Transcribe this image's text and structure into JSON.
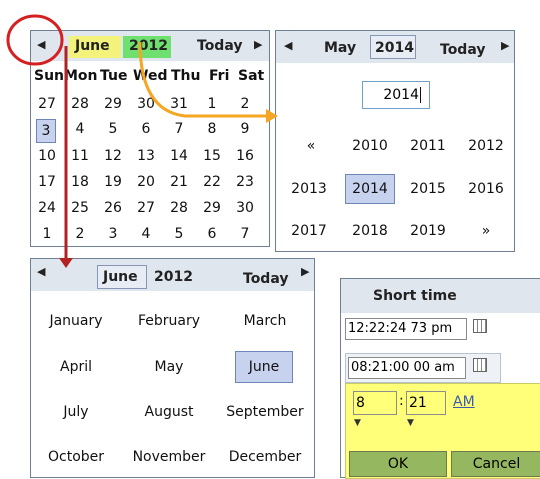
{
  "panel1": {
    "month": "June",
    "year": "2012",
    "today_label": "Today",
    "dow": [
      "Sun",
      "Mon",
      "Tue",
      "Wed",
      "Thu",
      "Fri",
      "Sat"
    ],
    "weeks": [
      [
        "27",
        "28",
        "29",
        "30",
        "31",
        "1",
        "2"
      ],
      [
        "3",
        "4",
        "5",
        "6",
        "7",
        "8",
        "9"
      ],
      [
        "10",
        "11",
        "12",
        "13",
        "14",
        "15",
        "16"
      ],
      [
        "17",
        "18",
        "19",
        "20",
        "21",
        "22",
        "23"
      ],
      [
        "24",
        "25",
        "26",
        "27",
        "28",
        "29",
        "30"
      ],
      [
        "1",
        "2",
        "3",
        "4",
        "5",
        "6",
        "7"
      ]
    ],
    "selected_day": "3"
  },
  "panel2": {
    "month": "May",
    "year": "2014",
    "today_label": "Today",
    "year_input": "2014",
    "rows": [
      [
        "«",
        "2010",
        "2011",
        "2012"
      ],
      [
        "2013",
        "2014",
        "2015",
        "2016"
      ],
      [
        "2017",
        "2018",
        "2019",
        "»"
      ]
    ]
  },
  "panel3": {
    "month": "June",
    "year": "2012",
    "today_label": "Today",
    "months": [
      [
        "January",
        "February",
        "March"
      ],
      [
        "April",
        "May",
        "June"
      ],
      [
        "July",
        "August",
        "September"
      ],
      [
        "October",
        "November",
        "December"
      ]
    ]
  },
  "panel4": {
    "title": "Short time",
    "time1": "12:22:24 73 pm",
    "time2": "08:21:00 00 am",
    "hour": "8",
    "minute": "21",
    "ampm": "AM",
    "ok_label": "OK",
    "cancel_label": "Cancel"
  },
  "colors": {
    "header": "#dfe6ee",
    "selected": "#c7d3ee",
    "month_hl": "#f3f37b",
    "year_hl": "#6fe06f",
    "time_editor": "#ffff7a",
    "button": "#94b75f",
    "red_arrow": "#b22222",
    "orange_arrow": "#f5a623"
  }
}
